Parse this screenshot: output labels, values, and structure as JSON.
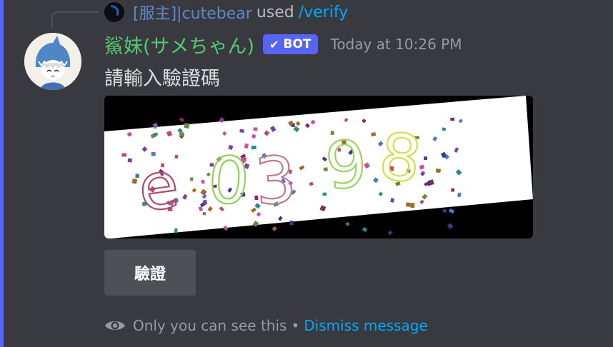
{
  "colors": {
    "background": "#383a40",
    "accent": "#5865f2",
    "author": "#57c86f",
    "reply_user": "#5d89c6",
    "link": "#00a8fc",
    "muted": "#949ba4"
  },
  "reply": {
    "username": "[服主]|cutebear",
    "used_text": "used",
    "command": "/verify",
    "avatar_icon": "moon-avatar-icon"
  },
  "message": {
    "author": "鯊妹(サメちゃん)",
    "bot_tag": "BOT",
    "bot_check_icon": "check-icon",
    "timestamp": "Today at 10:26 PM",
    "content": "請輸入驗證碼",
    "avatar_icon": "shark-girl-avatar"
  },
  "captcha": {
    "chars": [
      "e",
      "0",
      "3",
      "9",
      "8"
    ],
    "char_colors": [
      "#b04a6a",
      "#8fd35a",
      "#c07a8a",
      "#9bd460",
      "#d6dc4e"
    ],
    "background": "#ffffff"
  },
  "button": {
    "label": "驗證"
  },
  "footer": {
    "eye_icon": "eye-icon",
    "only_text": "Only you can see this",
    "separator": "•",
    "dismiss": "Dismiss message"
  }
}
